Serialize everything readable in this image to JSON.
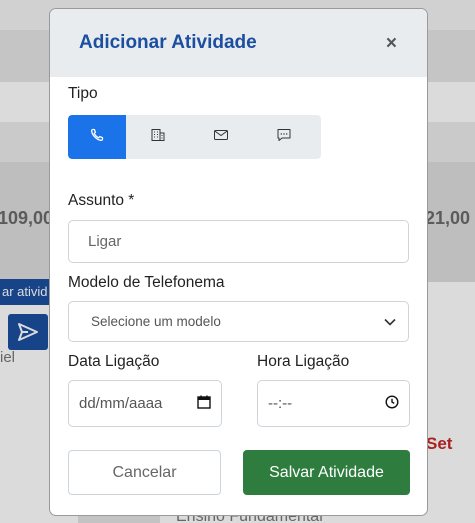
{
  "background": {
    "value_left": "109,00",
    "value_right": "21,00",
    "chip_label": "ar ativid",
    "text_iel": "iel",
    "set_label": "Set",
    "bottom_text": "Ensino Fundamental"
  },
  "modal": {
    "title": "Adicionar Atividade",
    "close_label": "×",
    "tipo_label": "Tipo",
    "types": [
      {
        "name": "phone",
        "icon": "phone-icon",
        "selected": true
      },
      {
        "name": "building",
        "icon": "building-icon",
        "selected": false
      },
      {
        "name": "mail",
        "icon": "mail-icon",
        "selected": false
      },
      {
        "name": "chat",
        "icon": "chat-icon",
        "selected": false
      }
    ],
    "assunto_label": "Assunto *",
    "assunto_value": "Ligar",
    "modelo_label": "Modelo de Telefonema",
    "modelo_placeholder": "Selecione um modelo",
    "data_label": "Data Ligação",
    "data_placeholder": "dd/mm/aaaa",
    "hora_label": "Hora Ligação",
    "hora_placeholder": "--:--",
    "cancel_label": "Cancelar",
    "save_label": "Salvar Atividade"
  },
  "colors": {
    "title": "#1b4fa0",
    "type_active": "#1a73e8",
    "save_button": "#2e7d3f",
    "set_text": "#c62828"
  }
}
